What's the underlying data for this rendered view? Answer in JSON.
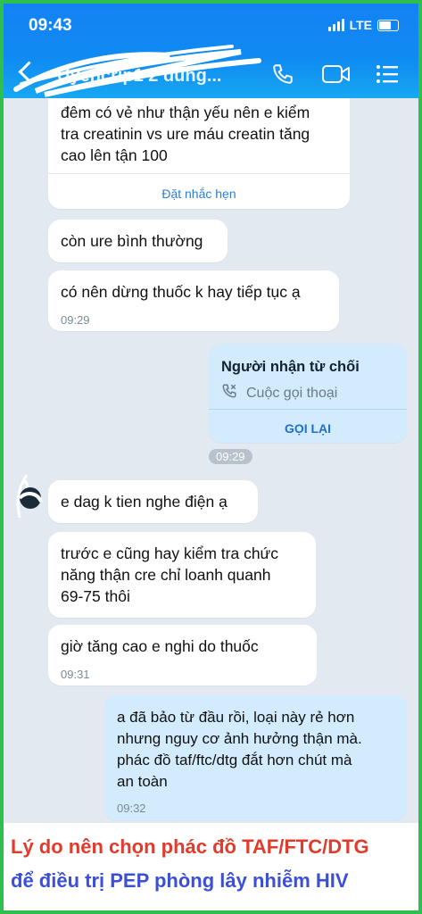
{
  "status_bar": {
    "time": "09:43",
    "network": "LTE"
  },
  "header": {
    "title": "Uyencrip1 2 dung...",
    "back_icon": "back-chevron-icon",
    "call_icon": "phone-icon",
    "video_icon": "video-camera-icon",
    "menu_icon": "menu-list-icon"
  },
  "messages": [
    {
      "text": "đêm có vẻ như thận yếu nên e kiểm\ntra creatinin vs ure máu creatin tăng\ncao lên tận 100",
      "action": "Đặt nhắc hẹn"
    },
    {
      "text": "còn ure bình thường"
    },
    {
      "text": "có nên dừng thuốc k hay tiếp tục ạ",
      "time": "09:29"
    },
    {
      "title": "Người nhận từ chối",
      "subtitle": "Cuộc gọi thoại",
      "action": "GỌI LẠI"
    },
    {
      "chip": "09:29"
    },
    {
      "text": "e dag k tien nghe điện ạ"
    },
    {
      "text": "trước e cũng hay kiểm tra chức\nnăng thận cre chỉ loanh quanh\n69-75 thôi"
    },
    {
      "text": "giờ tăng cao e nghi do thuốc",
      "time": "09:31"
    },
    {
      "text": "a đã bảo từ đầu rồi, loại này rẻ hơn\nnhưng nguy cơ ảnh hưởng thận mà.\nphác đồ taf/ftc/dtg đắt hơn chút mà\nan toàn",
      "time": "09:32"
    }
  ],
  "caption": {
    "line1": "Lý do nên chọn phác đồ TAF/FTC/DTG",
    "line2": "để điều trị PEP phòng lây nhiễm HIV"
  },
  "colors": {
    "header": "#1581f4",
    "my_bubble": "#d2ebfd",
    "caption_red": "#e03b2c",
    "caption_blue": "#3b4fd9",
    "border": "#2fbf4f"
  }
}
